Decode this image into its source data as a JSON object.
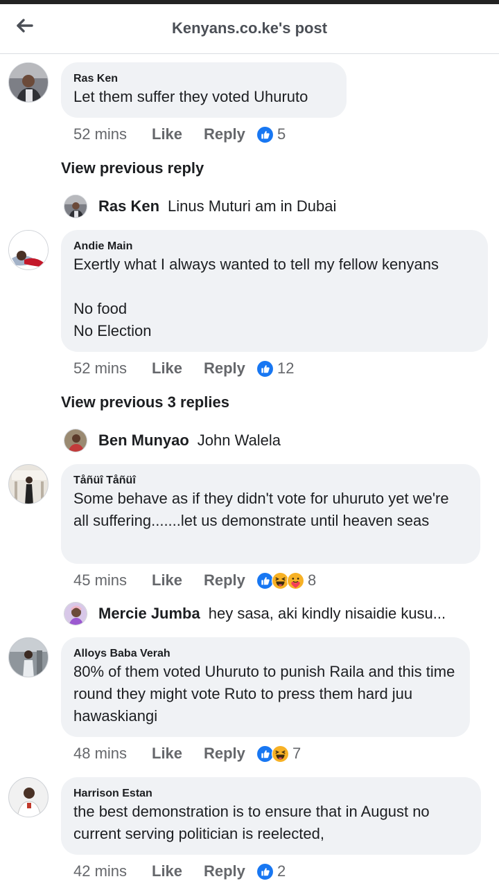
{
  "header": {
    "title": "Kenyans.co.ke's post",
    "back_icon": "arrow-left-icon"
  },
  "colors": {
    "like_blue": "#1877f2",
    "haha_yellow": "#f7b125",
    "bubble_bg": "#f0f2f5",
    "meta_gray": "#65676b"
  },
  "comments": [
    {
      "author": "Ras Ken",
      "text": "Let them suffer they voted Uhuruto",
      "time": "52 mins",
      "like": "Like",
      "reply": "Reply",
      "reactions": [
        "like"
      ],
      "reaction_count": "5",
      "view_previous": "View previous reply",
      "reply_preview": {
        "author": "Ras Ken",
        "text": "Linus Muturi am in Dubai"
      }
    },
    {
      "author": "Andie Main",
      "text": "Exertly what I always wanted to tell my fellow kenyans\n\nNo food\nNo Election",
      "time": "52 mins",
      "like": "Like",
      "reply": "Reply",
      "reactions": [
        "like"
      ],
      "reaction_count": "12",
      "view_previous": "View previous 3 replies",
      "reply_preview": {
        "author": "Ben Munyao",
        "text": "John Walela"
      }
    },
    {
      "author": "Tåñüî Tåñüî",
      "text": "Some behave as if they didn't vote for uhuruto yet we're all suffering.......let us demonstrate until heaven seas",
      "time": "45 mins",
      "like": "Like",
      "reply": "Reply",
      "reactions": [
        "like",
        "haha",
        "care"
      ],
      "reaction_count": "8",
      "reply_preview": {
        "author": "Mercie Jumba",
        "text": "hey sasa, aki kindly nisaidie kusu..."
      }
    },
    {
      "author": "Alloys Baba Verah",
      "text": "80% of them voted Uhuruto to punish Raila and this time round they might vote Ruto to press them hard juu hawaskiangi",
      "time": "48 mins",
      "like": "Like",
      "reply": "Reply",
      "reactions": [
        "like",
        "haha"
      ],
      "reaction_count": "7"
    },
    {
      "author": "Harrison Estan",
      "text": "the best demonstration is to ensure that in August no current serving politician is reelected,",
      "time": "42 mins",
      "like": "Like",
      "reply": "Reply",
      "reactions": [
        "like"
      ],
      "reaction_count": "2"
    }
  ]
}
